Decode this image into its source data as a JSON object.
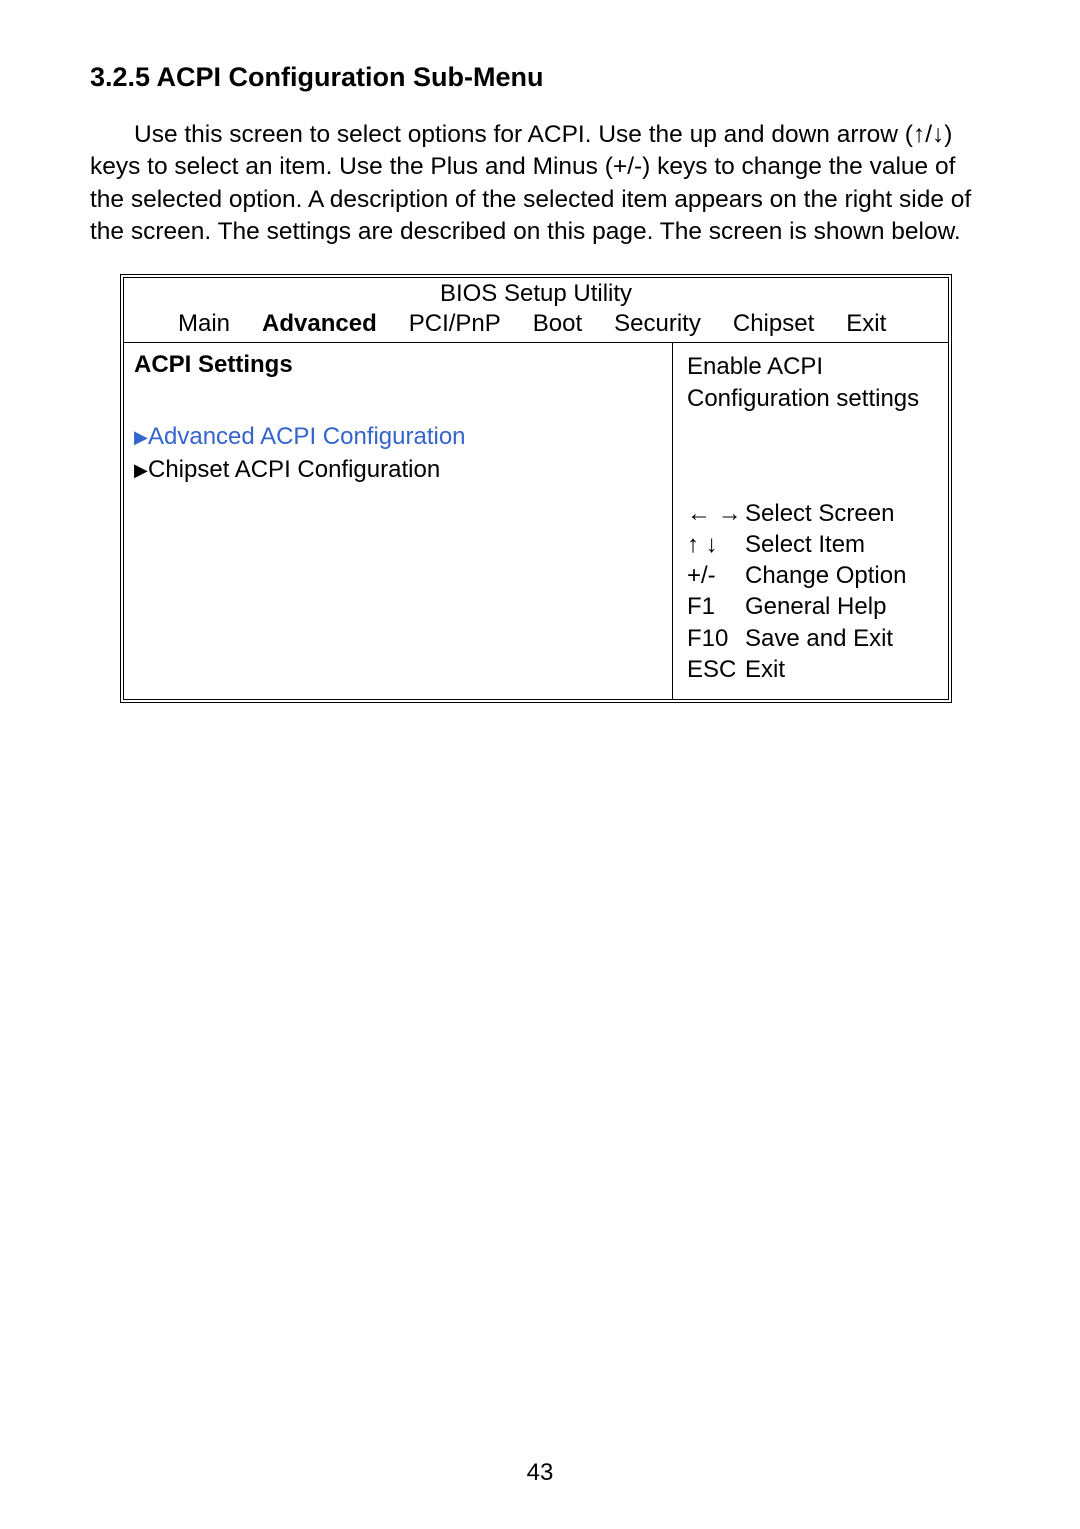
{
  "heading": "3.2.5 ACPI Configuration Sub-Menu",
  "intro": "Use this screen to select options for ACPI. Use the up and down arrow (↑/↓) keys to select an item. Use the Plus and Minus (+/-) keys to change the value of the selected option. A description of the selected item appears on the right side of the screen. The settings are described on this page. The screen is shown below.",
  "bios": {
    "title": "BIOS Setup Utility",
    "tabs": {
      "main": "Main",
      "advanced": "Advanced",
      "pcipnp": "PCI/PnP",
      "boot": "Boot",
      "security": "Security",
      "chipset": "Chipset",
      "exit": "Exit"
    },
    "left": {
      "section_title": "ACPI Settings",
      "item1": "Advanced ACPI Configuration",
      "item2": "Chipset ACPI Configuration"
    },
    "right": {
      "desc1": "Enable ACPI",
      "desc2": "Configuration settings",
      "help": {
        "k1": "← →",
        "l1": "Select Screen",
        "k2": "↑ ↓",
        "l2": "Select Item",
        "k3": "+/-",
        "l3": "Change Option",
        "k4": "F1",
        "l4": "General Help",
        "k5": "F10",
        "l5": "Save and Exit",
        "k6": "ESC",
        "l6": "Exit"
      }
    }
  },
  "page_number": "43"
}
